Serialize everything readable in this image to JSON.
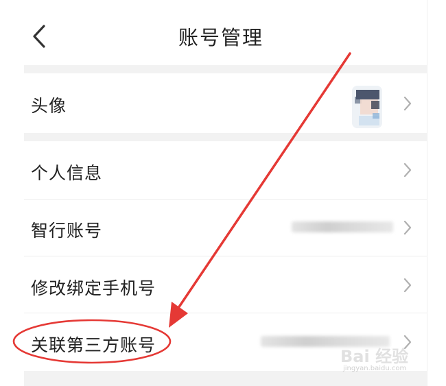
{
  "header": {
    "title": "账号管理",
    "back_icon": "chevron-left-icon"
  },
  "rows": [
    {
      "label": "头像",
      "value_type": "avatar",
      "chevron_icon": "chevron-right-icon"
    },
    {
      "label": "个人信息",
      "value_type": "none",
      "chevron_icon": "chevron-right-icon"
    },
    {
      "label": "智行账号",
      "value_type": "blurred-text",
      "chevron_icon": "chevron-right-icon"
    },
    {
      "label": "修改绑定手机号",
      "value_type": "none",
      "chevron_icon": "chevron-right-icon"
    },
    {
      "label": "关联第三方账号",
      "value_type": "blurred-text",
      "chevron_icon": "chevron-right-icon",
      "highlighted": true
    }
  ],
  "annotation": {
    "arrow_color": "#e53935",
    "ellipse_color": "#e53935"
  },
  "watermark": {
    "main": "Bai 经验",
    "sub": "jingyan.baidu.com"
  },
  "colors": {
    "background": "#ffffff",
    "separator": "#f2f2f2",
    "text": "#222222",
    "chevron": "#b0b0b0"
  }
}
